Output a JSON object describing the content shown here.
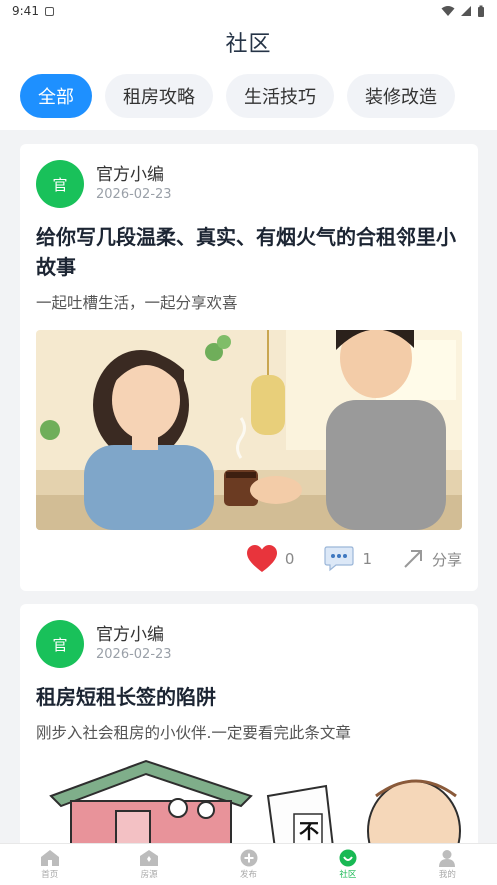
{
  "status": {
    "time": "9:41"
  },
  "header": {
    "title": "社区"
  },
  "tabs": [
    {
      "label": "全部",
      "active": true
    },
    {
      "label": "租房攻略",
      "active": false
    },
    {
      "label": "生活技巧",
      "active": false
    },
    {
      "label": "装修改造",
      "active": false
    }
  ],
  "posts": [
    {
      "avatar_text": "官",
      "author": "官方小编",
      "date": "2026-02-23",
      "title": "给你写几段温柔、真实、有烟火气的合租邻里小故事",
      "summary": "一起吐槽生活，一起分享欢喜",
      "likes": "0",
      "comments": "1",
      "share_label": "分享"
    },
    {
      "avatar_text": "官",
      "author": "官方小编",
      "date": "2026-02-23",
      "title": "租房短租长签的陷阱",
      "summary": "刚步入社会租房的小伙伴.一定要看完此条文章",
      "image_text": "不"
    }
  ],
  "bottom_nav": [
    {
      "label": "首页",
      "icon": "home-icon",
      "active": false
    },
    {
      "label": "房源",
      "icon": "house-icon",
      "active": false
    },
    {
      "label": "发布",
      "icon": "plus-circle-icon",
      "active": false
    },
    {
      "label": "社区",
      "icon": "community-icon",
      "active": true
    },
    {
      "label": "我的",
      "icon": "person-icon",
      "active": false
    }
  ],
  "colors": {
    "accent": "#1e90ff",
    "brand_green": "#19c15a",
    "like_red": "#e8343c"
  }
}
